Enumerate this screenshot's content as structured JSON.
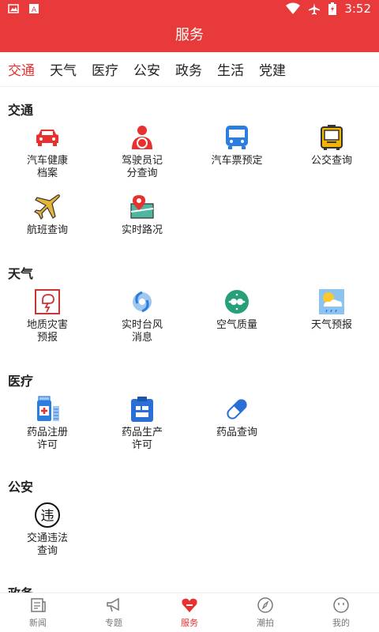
{
  "status_bar": {
    "time": "3:52"
  },
  "header": {
    "title": "服务"
  },
  "tabs": [
    {
      "label": "交通",
      "active": true
    },
    {
      "label": "天气"
    },
    {
      "label": "医疗"
    },
    {
      "label": "公安"
    },
    {
      "label": "政务"
    },
    {
      "label": "生活"
    },
    {
      "label": "党建"
    }
  ],
  "sections": {
    "traffic": {
      "title": "交通",
      "items": [
        {
          "label_lines": [
            "汽车健康",
            "档案"
          ]
        },
        {
          "label_lines": [
            "驾驶员记",
            "分查询"
          ]
        },
        {
          "label_lines": [
            "汽车票预定"
          ]
        },
        {
          "label_lines": [
            "公交查询"
          ]
        },
        {
          "label_lines": [
            "航班查询"
          ]
        },
        {
          "label_lines": [
            "实时路况"
          ]
        }
      ]
    },
    "weather": {
      "title": "天气",
      "items": [
        {
          "label_lines": [
            "地质灾害",
            "预报"
          ]
        },
        {
          "label_lines": [
            "实时台风",
            "消息"
          ]
        },
        {
          "label_lines": [
            "空气质量"
          ]
        },
        {
          "label_lines": [
            "天气预报"
          ]
        }
      ]
    },
    "medical": {
      "title": "医疗",
      "items": [
        {
          "label_lines": [
            "药品注册",
            "许可"
          ]
        },
        {
          "label_lines": [
            "药品生产",
            "许可"
          ]
        },
        {
          "label_lines": [
            "药品查询"
          ]
        }
      ]
    },
    "police": {
      "title": "公安",
      "items": [
        {
          "label_lines": [
            "交通违法",
            "查询"
          ]
        }
      ],
      "violation_glyph": "违"
    },
    "government": {
      "title": "政务"
    }
  },
  "bottom_nav": [
    {
      "label": "新闻"
    },
    {
      "label": "专题"
    },
    {
      "label": "服务",
      "active": true
    },
    {
      "label": "潮拍"
    },
    {
      "label": "我的"
    }
  ],
  "colors": {
    "brand_red": "#e83a3a",
    "active_red": "#e8302e"
  }
}
